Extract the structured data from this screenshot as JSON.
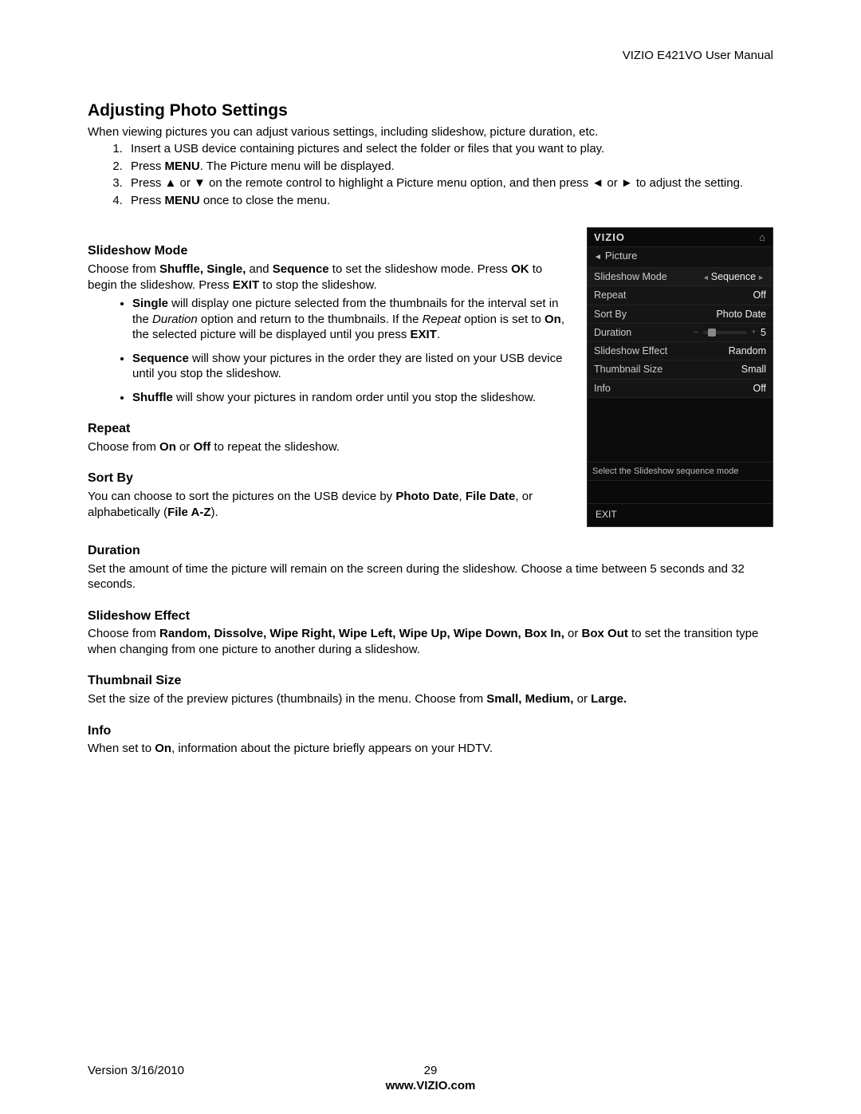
{
  "header": {
    "right": "VIZIO E421VO User Manual"
  },
  "title": "Adjusting Photo Settings",
  "intro": "When viewing pictures you can adjust various settings, including slideshow, picture duration, etc.",
  "steps": {
    "s1": "Insert a USB device containing pictures and select the folder or files that you want to play.",
    "s2a": "Press ",
    "s2b": "MENU",
    "s2c": ". The Picture menu will be displayed.",
    "s3a": "Press ▲ or ▼ on the remote control to highlight a Picture menu option, and then press ◄ or ► to adjust the setting.",
    "s4a": "Press ",
    "s4b": "MENU",
    "s4c": " once to close the menu."
  },
  "slideshow_mode": {
    "heading": "Slideshow Mode",
    "p1a": "Choose from ",
    "p1b": "Shuffle, Single,",
    "p1c": " and ",
    "p1d": "Sequence",
    "p1e": " to set the slideshow mode. Press ",
    "p1f": "OK",
    "p1g": " to begin the slideshow. Press ",
    "p1h": "EXIT",
    "p1i": " to stop the slideshow.",
    "b1a": "Single",
    "b1b": " will display one picture selected from the thumbnails for the interval set in the ",
    "b1c": "Duration",
    "b1d": " option and return to the thumbnails. If the ",
    "b1e": "Repeat",
    "b1f": " option is set to ",
    "b1g": "On",
    "b1h": ", the selected picture will be displayed until you press ",
    "b1i": "EXIT",
    "b1j": ".",
    "b2a": "Sequence",
    "b2b": " will show your pictures in the order they are listed on your USB device until you stop the slideshow.",
    "b3a": "Shuffle",
    "b3b": " will show your pictures in random order until you stop the slideshow."
  },
  "repeat": {
    "heading": "Repeat",
    "p1a": "Choose from ",
    "p1b": "On",
    "p1c": " or ",
    "p1d": "Off",
    "p1e": " to repeat the slideshow."
  },
  "sortby": {
    "heading": "Sort By",
    "p1a": "You can choose to sort the pictures on the USB device by ",
    "p1b": "Photo Date",
    "p1c": ", ",
    "p1d": "File Date",
    "p1e": ", or alphabetically (",
    "p1f": "File A-Z",
    "p1g": ")."
  },
  "duration": {
    "heading": "Duration",
    "p1": "Set the amount of time the picture will remain on the screen during the slideshow. Choose a time between 5 seconds and 32 seconds."
  },
  "effect": {
    "heading": "Slideshow Effect",
    "p1a": "Choose from ",
    "p1b": "Random, Dissolve, Wipe Right, Wipe Left, Wipe Up, Wipe Down, Box In,",
    "p1c": " or ",
    "p1d": "Box Out",
    "p1e": " to set the transition type when changing from one picture to another during a slideshow."
  },
  "thumb": {
    "heading": "Thumbnail Size",
    "p1a": "Set the size of the preview pictures (thumbnails) in the menu. Choose from ",
    "p1b": "Small, Medium,",
    "p1c": " or ",
    "p1d": "Large."
  },
  "info": {
    "heading": "Info",
    "p1a": "When set to ",
    "p1b": "On",
    "p1c": ", information about the picture briefly appears on your HDTV."
  },
  "osd": {
    "brand": "VIZIO",
    "crumb_arrow": "◄",
    "crumb": "Picture",
    "rows": {
      "slideshow_mode": {
        "label": "Slideshow Mode",
        "value": "Sequence"
      },
      "repeat": {
        "label": "Repeat",
        "value": "Off"
      },
      "sortby": {
        "label": "Sort By",
        "value": "Photo Date"
      },
      "duration": {
        "label": "Duration",
        "value": "5"
      },
      "effect": {
        "label": "Slideshow Effect",
        "value": "Random"
      },
      "thumb": {
        "label": "Thumbnail Size",
        "value": "Small"
      },
      "info": {
        "label": "Info",
        "value": "Off"
      }
    },
    "hint": "Select the Slideshow sequence mode",
    "exit": "EXIT"
  },
  "footer": {
    "left": "Version 3/16/2010",
    "page": "29",
    "url": "www.VIZIO.com"
  }
}
